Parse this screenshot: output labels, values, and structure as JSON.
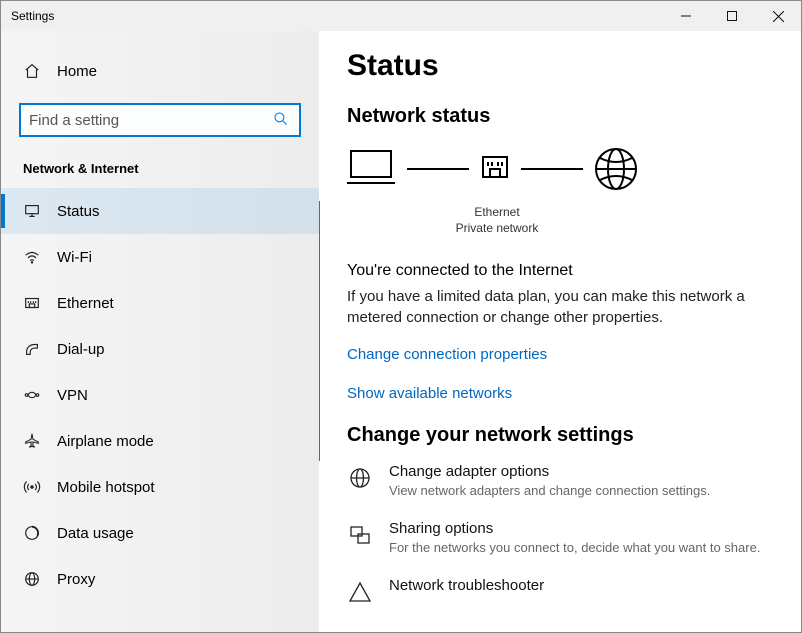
{
  "window": {
    "title": "Settings"
  },
  "sidebar": {
    "home": "Home",
    "searchPlaceholder": "Find a setting",
    "category": "Network & Internet",
    "items": [
      {
        "label": "Status"
      },
      {
        "label": "Wi-Fi"
      },
      {
        "label": "Ethernet"
      },
      {
        "label": "Dial-up"
      },
      {
        "label": "VPN"
      },
      {
        "label": "Airplane mode"
      },
      {
        "label": "Mobile hotspot"
      },
      {
        "label": "Data usage"
      },
      {
        "label": "Proxy"
      }
    ]
  },
  "main": {
    "title": "Status",
    "subtitle": "Network status",
    "diagram": {
      "adapterName": "Ethernet",
      "networkType": "Private network"
    },
    "connHeading": "You're connected to the Internet",
    "connDesc": "If you have a limited data plan, you can make this network a metered connection or change other properties.",
    "link1": "Change connection properties",
    "link2": "Show available networks",
    "section2Title": "Change your network settings",
    "rows": [
      {
        "title": "Change adapter options",
        "desc": "View network adapters and change connection settings."
      },
      {
        "title": "Sharing options",
        "desc": "For the networks you connect to, decide what you want to share."
      },
      {
        "title": "Network troubleshooter",
        "desc": ""
      }
    ]
  }
}
